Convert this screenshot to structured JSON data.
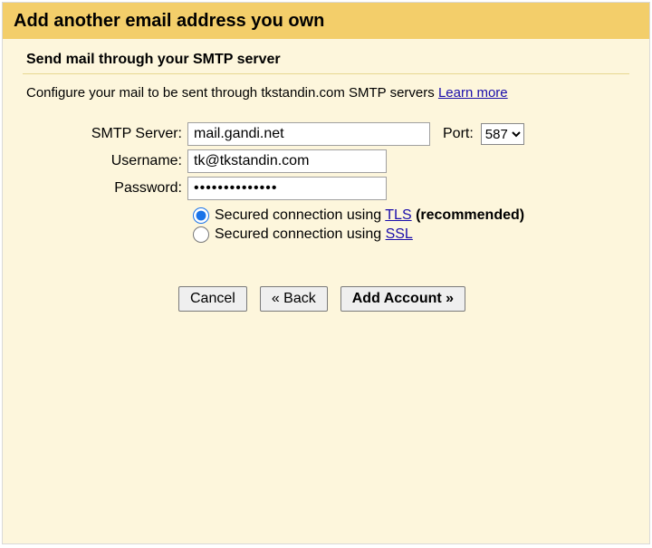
{
  "title": "Add another email address you own",
  "section_title": "Send mail through your SMTP server",
  "instruction_prefix": "Configure your mail to be sent through tkstandin.com SMTP servers ",
  "learn_more": "Learn more",
  "form": {
    "smtp_label": "SMTP Server:",
    "smtp_value": "mail.gandi.net",
    "port_label": "Port:",
    "port_value": "587",
    "port_options": [
      "587"
    ],
    "username_label": "Username:",
    "username_value": "tk@tkstandin.com",
    "password_label": "Password:",
    "password_value": "••••••••••••••"
  },
  "radio": {
    "tls_prefix": "Secured connection using ",
    "tls_link": "TLS",
    "tls_suffix": " (recommended)",
    "ssl_prefix": "Secured connection using ",
    "ssl_link": "SSL",
    "selected": "tls"
  },
  "buttons": {
    "cancel": "Cancel",
    "back": "« Back",
    "add": "Add Account »"
  }
}
